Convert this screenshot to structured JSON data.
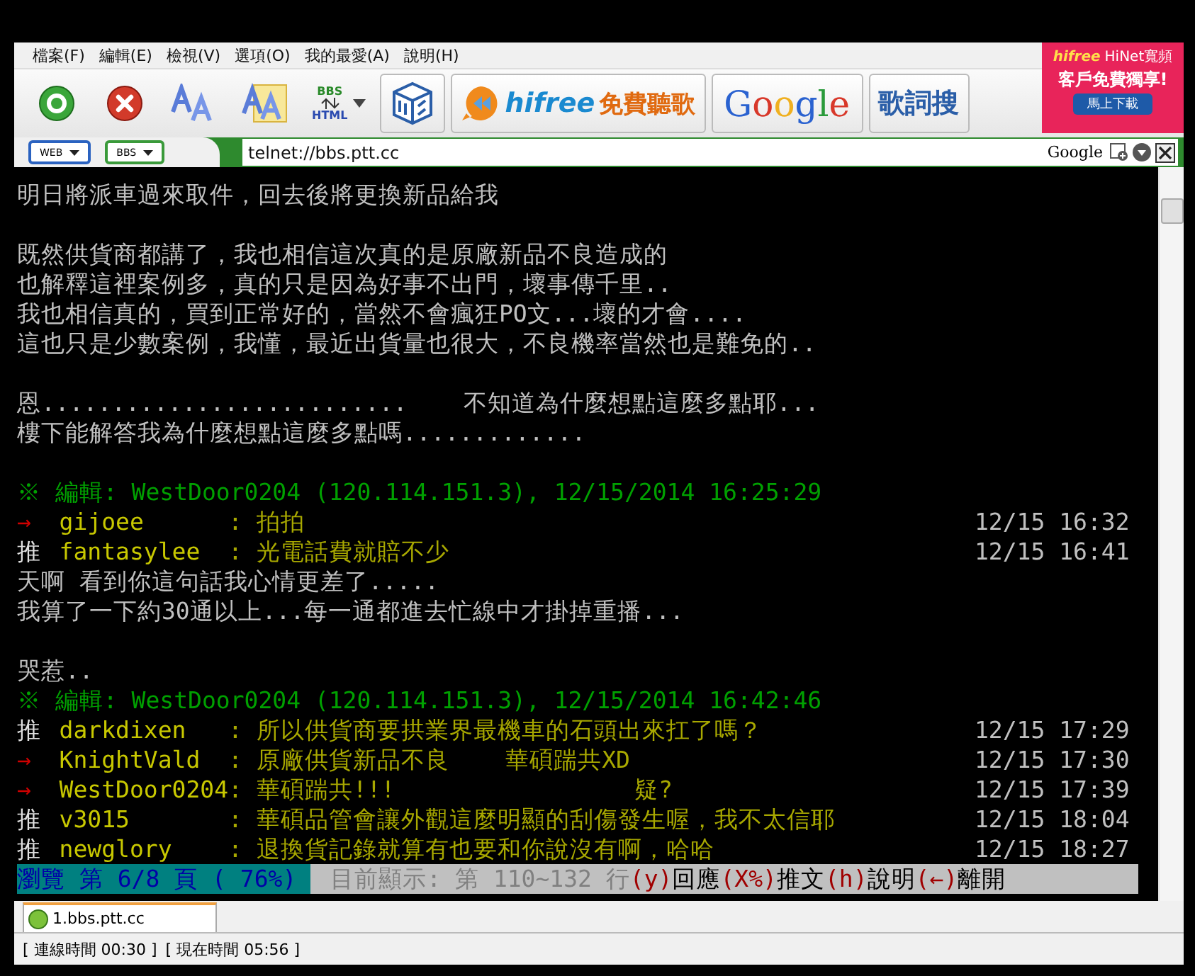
{
  "menu": [
    "檔案(F)",
    "編輯(E)",
    "檢視(V)",
    "選項(O)",
    "我的最愛(A)",
    "說明(H)"
  ],
  "toolbar": {
    "bbs_html": {
      "top": "BBS",
      "bottom": "HTML"
    },
    "music": {
      "brand": "hifree",
      "text": "免費聽歌"
    },
    "google": "Google",
    "lyrics": "歌詞搜"
  },
  "ad": {
    "brand": "hifree",
    "title": "HiNet寬頻",
    "line": "客戶免費獨享!",
    "button": "馬上下載"
  },
  "address_bar": {
    "modes": [
      "WEB",
      "BBS"
    ],
    "url": "telnet://bbs.ptt.cc",
    "search_engine": "Google"
  },
  "terminal": {
    "lines": [
      {
        "kind": "text",
        "text": "明日將派車過來取件，回去後將更換新品給我"
      },
      {
        "kind": "blank"
      },
      {
        "kind": "text",
        "text": "既然供貨商都講了，我也相信這次真的是原廠新品不良造成的"
      },
      {
        "kind": "text",
        "text": "也解釋這裡案例多，真的只是因為好事不出門，壞事傳千里.."
      },
      {
        "kind": "text",
        "text": "我也相信真的，買到正常好的，當然不會瘋狂PO文...壞的才會...."
      },
      {
        "kind": "text",
        "text": "這也只是少數案例，我懂，最近出貨量也很大，不良機率當然也是難免的.."
      },
      {
        "kind": "blank"
      },
      {
        "kind": "text",
        "text": "恩..........................    不知道為什麼想點這麼多點耶..."
      },
      {
        "kind": "text",
        "text": "樓下能解答我為什麼想點這麼多點嗎............."
      },
      {
        "kind": "blank"
      },
      {
        "kind": "edit",
        "text": "※ 編輯: WestDoor0204 (120.114.151.3), 12/15/2014 16:25:29"
      },
      {
        "kind": "arrow",
        "tag": "→",
        "user": "gijoee",
        "content": ": 拍拍",
        "time": "12/15 16:32"
      },
      {
        "kind": "push",
        "tag": "推",
        "user": "fantasylee",
        "content": ": 光電話費就賠不少",
        "time": "12/15 16:41"
      },
      {
        "kind": "text",
        "text": "天啊 看到你這句話我心情更差了....."
      },
      {
        "kind": "text",
        "text": "我算了一下約30通以上...每一通都進去忙線中才掛掉重播..."
      },
      {
        "kind": "blank"
      },
      {
        "kind": "text",
        "text": "哭惹.."
      },
      {
        "kind": "edit",
        "text": "※ 編輯: WestDoor0204 (120.114.151.3), 12/15/2014 16:42:46"
      },
      {
        "kind": "push",
        "tag": "推",
        "user": "darkdixen",
        "content": ": 所以供貨商要拱業界最機車的石頭出來扛了嗎？",
        "time": "12/15 17:29"
      },
      {
        "kind": "arrow",
        "tag": "→",
        "user": "KnightVald",
        "content": ": 原廠供貨新品不良    華碩踹共XD",
        "time": "12/15 17:30"
      },
      {
        "kind": "arrow",
        "tag": "→",
        "user": "WestDoor0204",
        "content": ": 華碩踹共!!!                 疑?",
        "time": "12/15 17:39"
      },
      {
        "kind": "push",
        "tag": "推",
        "user": "v3015",
        "content": ": 華碩品管會讓外觀這麼明顯的刮傷發生喔，我不太信耶",
        "time": "12/15 18:04"
      },
      {
        "kind": "push",
        "tag": "推",
        "user": "newglory",
        "content": ": 退換貨記錄就算有也要和你說沒有啊，哈哈",
        "time": "12/15 18:27"
      }
    ],
    "status": {
      "page_info": "瀏覽 第 6/8 頁 ( 76%)",
      "position": "目前顯示: 第 110~132 行",
      "keys": [
        {
          "key": "(y)",
          "label": "回應"
        },
        {
          "key": "(X%)",
          "label": "推文"
        },
        {
          "key": "(h)",
          "label": "說明"
        },
        {
          "key": "(←)",
          "label": "離開"
        }
      ]
    }
  },
  "tabs": [
    {
      "label": "1.bbs.ptt.cc",
      "selected": true
    }
  ],
  "status_bar": [
    "[ 連線時間 00:30 ]",
    "[ 現在時間 05:56 ]"
  ]
}
